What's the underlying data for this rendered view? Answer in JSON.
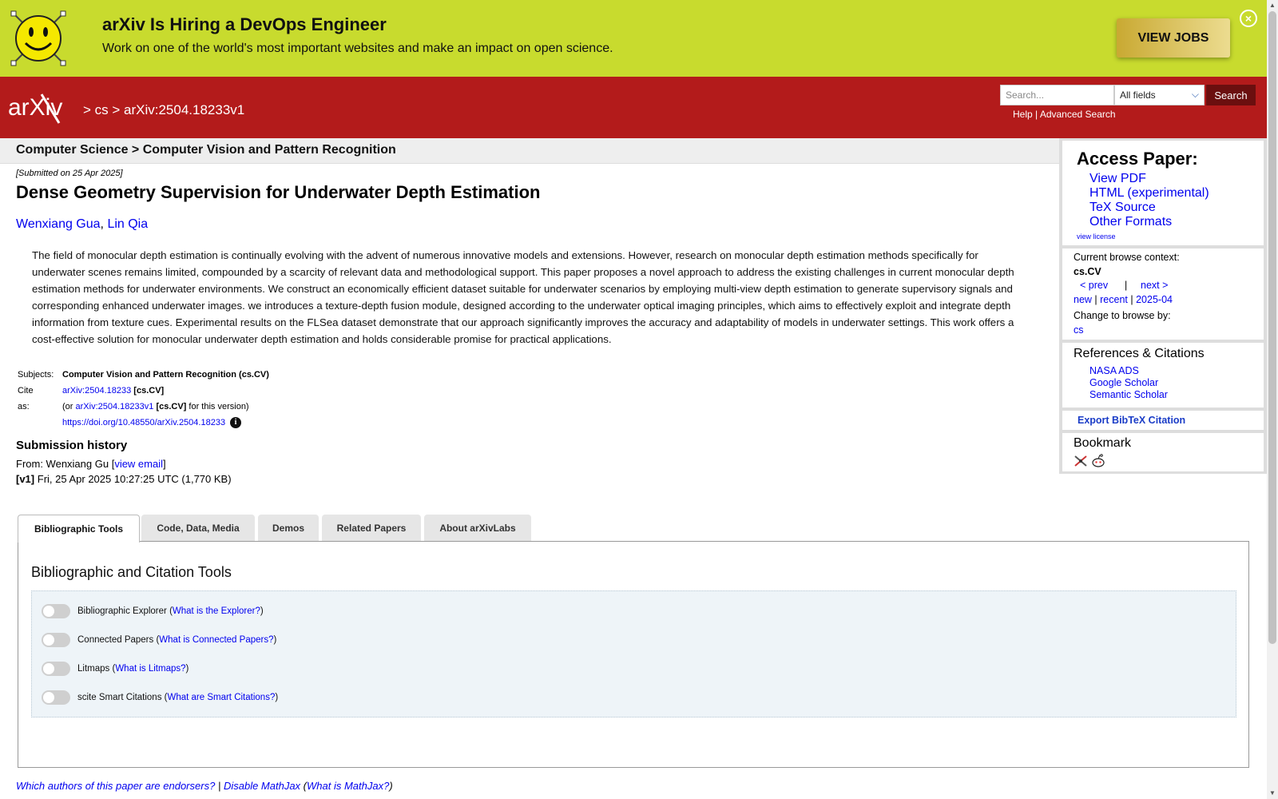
{
  "banner": {
    "title": "arXiv Is Hiring a DevOps Engineer",
    "text": "Work on one of the world's most important websites and make an impact on open science.",
    "button": "VIEW JOBS",
    "close_icon": "close-circle-icon"
  },
  "header": {
    "logo_text": "arXiv",
    "breadcrumb": "> cs > arXiv:2504.18233v1",
    "search_placeholder": "Search...",
    "field_select": "All fields",
    "search_button": "Search",
    "help_link": "Help",
    "separator": "|",
    "advanced_link": "Advanced Search"
  },
  "subheader": "Computer Science > Computer Vision and Pattern Recognition",
  "paper": {
    "submitted": "[Submitted on 25 Apr 2025]",
    "title": "Dense Geometry Supervision for Underwater Depth Estimation",
    "authors": [
      "Wenxiang Gua",
      "Lin Qia"
    ],
    "author_sep": ", ",
    "abstract": "The field of monocular depth estimation is continually evolving with the advent of numerous innovative models and extensions. However, research on monocular depth estimation methods specifically for underwater scenes remains limited, compounded by a scarcity of relevant data and methodological support. This paper proposes a novel approach to address the existing challenges in current monocular depth estimation methods for underwater environments. We construct an economically efficient dataset suitable for underwater scenarios by employing multi-view depth estimation to generate supervisory signals and corresponding enhanced underwater images. we introduces a texture-depth fusion module, designed according to the underwater optical imaging principles, which aims to effectively exploit and integrate depth information from texture cues. Experimental results on the FLSea dataset demonstrate that our approach significantly improves the accuracy and adaptability of models in underwater settings. This work offers a cost-effective solution for monocular underwater depth estimation and holds considerable promise for practical applications."
  },
  "meta": {
    "subjects_label": "Subjects:",
    "subjects_value": "Computer Vision and Pattern Recognition (cs.CV)",
    "cite_label": "Cite as:",
    "cite_id": "arXiv:2504.18233",
    "cite_cat": "[cs.CV]",
    "version_prefix": "(or",
    "version_id": "arXiv:2504.18233v1",
    "version_cat": "[cs.CV]",
    "version_suffix": "for this version)",
    "doi": "https://doi.org/10.48550/arXiv.2504.18233",
    "info_icon": "i"
  },
  "history": {
    "title": "Submission history",
    "from_prefix": "From: Wenxiang Gu [",
    "view_email": "view email",
    "from_suffix": "]",
    "v1_label": "[v1]",
    "v1_text": "Fri, 25 Apr 2025 10:27:25 UTC (1,770 KB)"
  },
  "tabs": [
    {
      "label": "Bibliographic Tools",
      "active": true
    },
    {
      "label": "Code, Data, Media"
    },
    {
      "label": "Demos"
    },
    {
      "label": "Related Papers"
    },
    {
      "label": "About arXivLabs"
    }
  ],
  "tools": {
    "title": "Bibliographic and Citation Tools",
    "items": [
      {
        "name": "Bibliographic Explorer",
        "link": "What is the Explorer?",
        "enabled": false
      },
      {
        "name": "Connected Papers",
        "link": "What is Connected Papers?",
        "enabled": false
      },
      {
        "name": "Litmaps",
        "link": "What is Litmaps?",
        "enabled": false
      },
      {
        "name": "scite Smart Citations",
        "link": "What are Smart Citations?",
        "enabled": false
      }
    ]
  },
  "footer": {
    "endorsers": "Which authors of this paper are endorsers?",
    "sep": "|",
    "disable_mathjax": "Disable MathJax",
    "what_mathjax": "What is MathJax?"
  },
  "sidebar": {
    "access_title": "Access Paper:",
    "access_links": [
      "View PDF",
      "HTML (experimental)",
      "TeX Source",
      "Other Formats"
    ],
    "view_license": "view license",
    "browse_label": "Current browse context:",
    "browse_context": "cs.CV",
    "prev": "< prev",
    "nav_sep": "|",
    "next": "next >",
    "new": "new",
    "recent": "recent",
    "month": "2025-04",
    "change_label": "Change to browse by:",
    "change_cs": "cs",
    "refs_title": "References & Citations",
    "refs_links": [
      "NASA ADS",
      "Google Scholar",
      "Semantic Scholar"
    ],
    "export_bibtex": "Export BibTeX Citation",
    "bookmark_title": "Bookmark",
    "bookmark_icons": [
      "bibsonomy-icon",
      "reddit-icon"
    ]
  },
  "colors": {
    "banner": "#c8db2e",
    "header": "#b31b1b",
    "link": "#0000ee"
  }
}
